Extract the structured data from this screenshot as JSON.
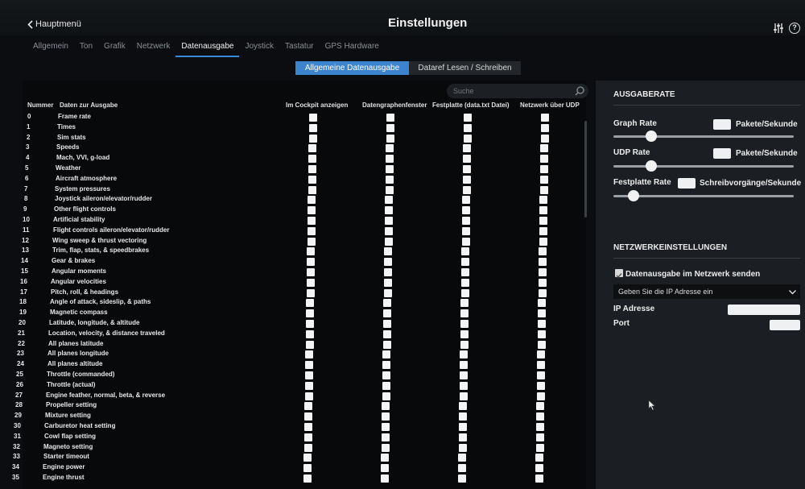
{
  "header": {
    "back_label": "Hauptmenü",
    "title": "Einstellungen"
  },
  "icons": {
    "back": "chevron-left-icon",
    "sliders": "sliders-icon",
    "help": "help-icon",
    "search": "search-icon",
    "dropdown": "chevron-down-icon",
    "cursor": "mouse-pointer-icon"
  },
  "tabs": [
    {
      "label": "Allgemein",
      "active": false
    },
    {
      "label": "Ton",
      "active": false
    },
    {
      "label": "Grafik",
      "active": false
    },
    {
      "label": "Netzwerk",
      "active": false
    },
    {
      "label": "Datenausgabe",
      "active": true
    },
    {
      "label": "Joystick",
      "active": false
    },
    {
      "label": "Tastatur",
      "active": false
    },
    {
      "label": "GPS Hardware",
      "active": false
    }
  ],
  "segments": {
    "general": "Allgemeine Datenausgabe",
    "dataref": "Dataref Lesen / Schreiben"
  },
  "search": {
    "placeholder": "Suche"
  },
  "table": {
    "headers": {
      "number": "Nummer",
      "label": "Daten zur Ausgabe",
      "cockpit": "Im Cockpit anzeigen",
      "graph": "Datengraphenfenster",
      "disk": "Festplatte (data.txt Datei)",
      "udp": "Netzwerk über UDP"
    },
    "rows": [
      {
        "n": "0",
        "label": "Frame rate"
      },
      {
        "n": "1",
        "label": "Times"
      },
      {
        "n": "2",
        "label": "Sim stats"
      },
      {
        "n": "3",
        "label": "Speeds"
      },
      {
        "n": "4",
        "label": "Mach, VVI, g-load"
      },
      {
        "n": "5",
        "label": "Weather"
      },
      {
        "n": "6",
        "label": "Aircraft atmosphere"
      },
      {
        "n": "7",
        "label": "System pressures"
      },
      {
        "n": "8",
        "label": "Joystick aileron/elevator/rudder"
      },
      {
        "n": "9",
        "label": "Other flight controls"
      },
      {
        "n": "10",
        "label": "Artificial stability"
      },
      {
        "n": "11",
        "label": "Flight controls aileron/elevator/rudder"
      },
      {
        "n": "12",
        "label": "Wing sweep & thrust vectoring"
      },
      {
        "n": "13",
        "label": "Trim, flap, stats, & speedbrakes"
      },
      {
        "n": "14",
        "label": "Gear & brakes"
      },
      {
        "n": "15",
        "label": "Angular moments"
      },
      {
        "n": "16",
        "label": "Angular velocities"
      },
      {
        "n": "17",
        "label": "Pitch, roll, & headings"
      },
      {
        "n": "18",
        "label": "Angle of attack, sideslip, & paths"
      },
      {
        "n": "19",
        "label": "Magnetic compass"
      },
      {
        "n": "20",
        "label": "Latitude, longitude, & altitude"
      },
      {
        "n": "21",
        "label": "Location, velocity, & distance traveled"
      },
      {
        "n": "22",
        "label": "All planes latitude"
      },
      {
        "n": "23",
        "label": "All planes longitude"
      },
      {
        "n": "24",
        "label": "All planes altitude"
      },
      {
        "n": "25",
        "label": "Throttle (commanded)"
      },
      {
        "n": "26",
        "label": "Throttle (actual)"
      },
      {
        "n": "27",
        "label": "Engine feather, normal, beta, & reverse"
      },
      {
        "n": "28",
        "label": "Propeller setting"
      },
      {
        "n": "29",
        "label": "Mixture setting"
      },
      {
        "n": "30",
        "label": "Carburetor heat setting"
      },
      {
        "n": "31",
        "label": "Cowl flap setting"
      },
      {
        "n": "32",
        "label": "Magneto setting"
      },
      {
        "n": "33",
        "label": "Starter timeout"
      },
      {
        "n": "34",
        "label": "Engine power"
      },
      {
        "n": "35",
        "label": "Engine thrust"
      }
    ]
  },
  "output_rate": {
    "title": "AUSGABERATE",
    "graph_label": "Graph Rate",
    "udp_label": "UDP Rate",
    "disk_label": "Festplatte Rate",
    "packets_unit": "Pakete/Sekunde",
    "writes_unit": "Schreibvorgänge/Sekunde",
    "graph_level": 0.21,
    "udp_level": 0.21,
    "disk_level": 0.11
  },
  "network": {
    "title": "NETZWERKEINSTELLUNGEN",
    "send_label": "Datenausgabe im Netzwerk senden",
    "send_checked": true,
    "ip_select": "Geben Sie die IP Adresse ein",
    "ip_label": "IP Adresse",
    "port_label": "Port"
  },
  "colors": {
    "accent": "#3d84cf",
    "background": "#0b0d10",
    "panel": "#1b1f23"
  }
}
